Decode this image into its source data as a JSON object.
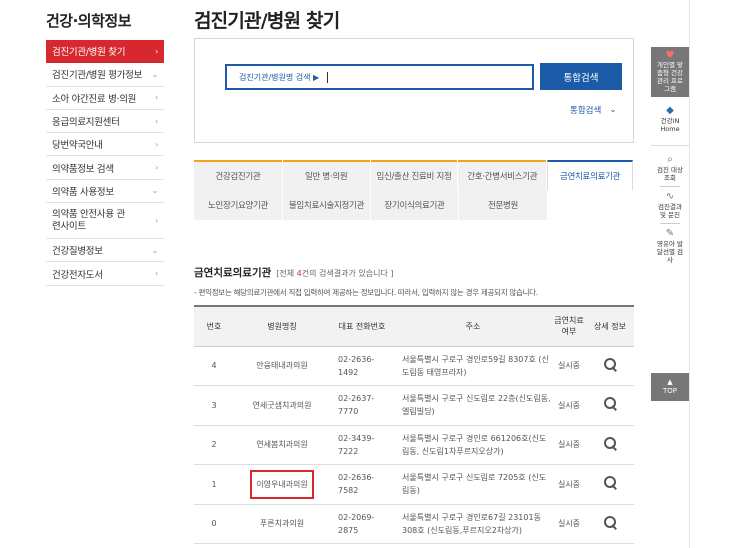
{
  "sidebar": {
    "title": "건강·의학정보",
    "items": [
      {
        "label": "검진기관/병원 찾기",
        "arrow": "›"
      },
      {
        "label": "검진기관/병원 평가정보",
        "arrow": "⌄"
      },
      {
        "label": "소아 야간진료 병·의원",
        "arrow": "›"
      },
      {
        "label": "응급의료지원센터",
        "arrow": "›"
      },
      {
        "label": "당번약국안내",
        "arrow": "›"
      },
      {
        "label": "의약품정보 검색",
        "arrow": "›"
      },
      {
        "label": "의약품 사용정보",
        "arrow": "⌄"
      },
      {
        "label": "의약품 안전사용 관련사이트",
        "arrow": "›"
      },
      {
        "label": "건강질병정보",
        "arrow": "⌄"
      },
      {
        "label": "건강전자도서",
        "arrow": "›"
      }
    ]
  },
  "page": {
    "title": "검진기관/병원 찾기"
  },
  "search": {
    "placeholder": "검진기관/병원명 검색 ▶",
    "button": "통합검색",
    "option": "통합검색",
    "option_icon": "chevron-down-icon"
  },
  "tabs": {
    "row1": [
      "건강검진기관",
      "일반 병·의원",
      "임신/출산 진료비 지정",
      "간호·간병서비스기관",
      "금연치료의료기관"
    ],
    "row2": [
      "노인장기요양기관",
      "불임치료시술지정기관",
      "장기이식의료기관",
      "전문병원"
    ],
    "active": "금연치료의료기관"
  },
  "results": {
    "title": "금연치료의료기관",
    "count_prefix": "[전체 ",
    "count": "4",
    "count_suffix": "건의 검색결과가 있습니다 ]",
    "notice": "- 편익정보는 해당의료기관에서 직접 입력하여 제공하는 정보입니다. 따라서, 입력하지 않는 경우 제공되지 않습니다.",
    "columns": [
      "번호",
      "병원명칭",
      "대표 전화번호",
      "주소",
      "금연치료 여부",
      "상세 정보"
    ],
    "rows": [
      {
        "no": "4",
        "name": "안융태내과의원",
        "phone": "02-2636-1492",
        "addr": "서울특별시 구로구 경인로59길 8307호 (신도림동 태영프라자)",
        "status": "실시중"
      },
      {
        "no": "3",
        "name": "연세굿샘치과의원",
        "phone": "02-2637-7770",
        "addr": "서울특별시 구로구 신도림로 22층(신도림동, 엘림빌딩)",
        "status": "실시중"
      },
      {
        "no": "2",
        "name": "연세봄치과의원",
        "phone": "02-3439-7222",
        "addr": "서울특별시 구로구 경인로 661206호(신도림동, 신도림1차푸르지오상가)",
        "status": "실시중"
      },
      {
        "no": "1",
        "name": "이영우내과의원",
        "phone": "02-2636-7582",
        "addr": "서울특별시 구로구 신도림로 7205호 (신도림동)",
        "status": "실시중"
      },
      {
        "no": "0",
        "name": "푸른치과의원",
        "phone": "02-2069-2875",
        "addr": "서울특별시 구로구 경인로67길 23101동308호 (신도림동,푸르지오2차상가)",
        "status": "실시중"
      }
    ],
    "highlight_color": "#d7282f"
  },
  "quickbar": {
    "personal": "개인별 맞춤형 건강관리 프로그램",
    "home": "건강iN Home",
    "checkup": "검진 대상조회",
    "results": "검진결과 및 문진",
    "child": "영유아 발달선별 검사",
    "top": "TOP"
  },
  "colors": {
    "brand_red": "#d7282f",
    "brand_blue": "#1b5ba8",
    "tab_orange": "#f0a51c"
  }
}
